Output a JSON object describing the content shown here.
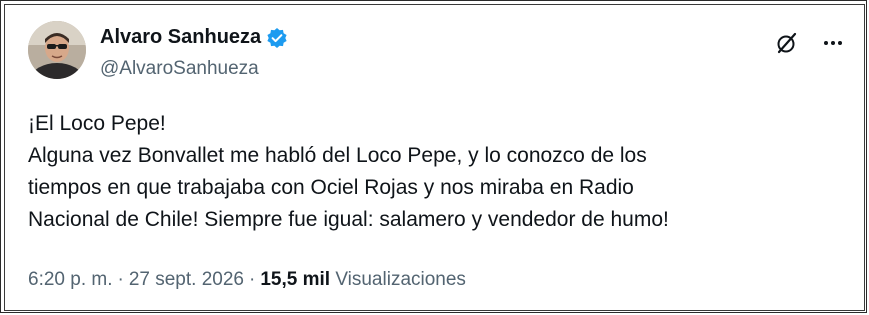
{
  "author": {
    "display_name": "Alvaro Sanhueza",
    "handle": "@AlvaroSanhueza",
    "verified": true,
    "verified_color": "#1d9bf0"
  },
  "actions": {
    "icons": [
      "grok-icon",
      "more-icon"
    ]
  },
  "tweet": {
    "lines": [
      "¡El Loco Pepe!",
      "Alguna vez Bonvallet me habló del Loco Pepe, y lo conozco de los",
      "tiempos en que trabajaba con Ociel Rojas y nos miraba en Radio",
      "Nacional de Chile! Siempre fue igual: salamero y vendedor de humo!"
    ]
  },
  "meta": {
    "time": "6:20 p. m.",
    "separator": "·",
    "date": "27 sept. 2026",
    "views_count": "15,5 mil",
    "views_label": "Visualizaciones"
  },
  "colors": {
    "text": "#0f1419",
    "secondary": "#536471",
    "accent": "#1d9bf0"
  }
}
